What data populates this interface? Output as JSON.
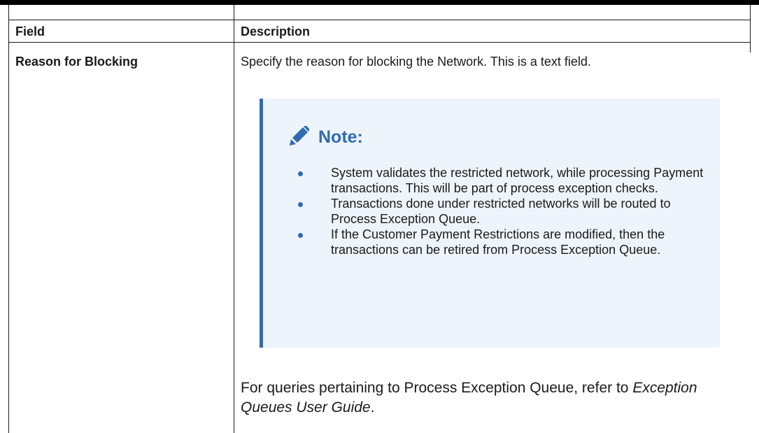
{
  "table": {
    "headers": [
      "Field",
      "Description"
    ],
    "row": {
      "field": "Reason for Blocking",
      "description": "Specify the reason for blocking the Network. This is a text field."
    }
  },
  "note": {
    "icon": "pencil-icon",
    "accent_color": "#2f6bb2",
    "background_color": "#eef4fb",
    "title": "Note:",
    "items": [
      "System validates the restricted network, while processing Payment transactions. This will be part of process exception checks.",
      "Transactions done under restricted networks will be routed to Process Exception Queue.",
      "If the Customer Payment Restrictions are modified, then the transactions can be retired from Process Exception Queue."
    ]
  },
  "reference": {
    "text": "For queries pertaining to Process Exception Queue, refer to",
    "guide": "Exception Queues User Guide",
    "end": "."
  }
}
